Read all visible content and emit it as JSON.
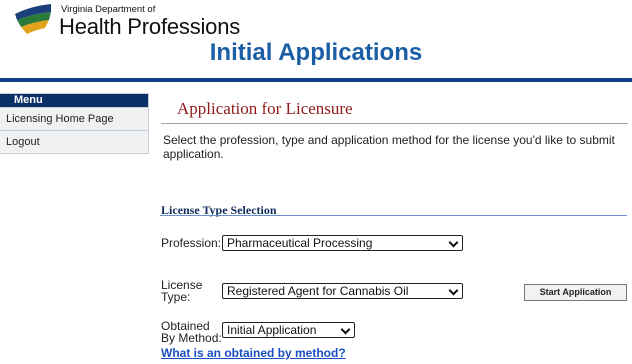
{
  "header": {
    "dept_line1": "Virginia Department of",
    "dept_line2": "Health Professions",
    "title": "Initial Applications"
  },
  "menu": {
    "title": "Menu",
    "items": [
      {
        "label": "Licensing Home Page"
      },
      {
        "label": "Logout"
      }
    ]
  },
  "main": {
    "section_title": "Application for Licensure",
    "instructions": "Select the profession, type and application method for the license you'd like to submit application.",
    "subsection_title": "License Type Selection",
    "profession": {
      "label": "Profession:",
      "value": "Pharmaceutical Processing"
    },
    "license_type": {
      "label_line1": "License",
      "label_line2": "Type:",
      "value": "Registered Agent for Cannabis Oil"
    },
    "obtained_by": {
      "label_line1": "Obtained",
      "label_line2": "By Method:",
      "value": "Initial Application"
    },
    "start_button": "Start Application",
    "help_link": "What is an obtained by method?"
  },
  "colors": {
    "title_blue": "#1a5ea5",
    "rule_navy": "#0f3e85",
    "section_red": "#8e1a1a",
    "menu_header": "#0b2f67"
  },
  "icons": {
    "logo": "virginia-state-shape-logo"
  }
}
